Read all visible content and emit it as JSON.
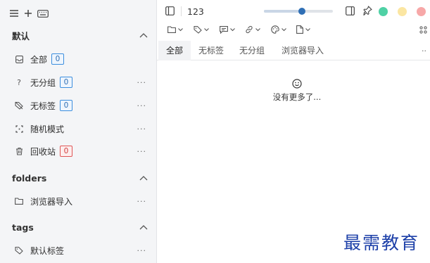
{
  "sidebar": {
    "top_icons": [
      "menu-icon",
      "plus-icon",
      "keyboard-icon"
    ],
    "groups": [
      {
        "title": "默认",
        "items": [
          {
            "label": "全部",
            "badge": "0",
            "icon": "inbox-icon"
          },
          {
            "label": "无分组",
            "badge": "0",
            "icon": "question-icon"
          },
          {
            "label": "无标签",
            "badge": "0",
            "icon": "tag-off-icon"
          },
          {
            "label": "随机模式",
            "icon": "shuffle-icon"
          },
          {
            "label": "回收站",
            "badge": "0",
            "icon": "trash-icon"
          }
        ]
      },
      {
        "title": "folders",
        "items": [
          {
            "label": "浏览器导入",
            "icon": "folder-icon"
          }
        ]
      },
      {
        "title": "tags",
        "items": [
          {
            "label": "默认标签",
            "icon": "tag-icon"
          }
        ]
      }
    ],
    "more_label": "···"
  },
  "header": {
    "title": "123",
    "zoom_slider": {
      "value_fraction": 0.55
    },
    "window_dots": {
      "green": "#4fd1a5",
      "yellow": "#fbe6a2",
      "red": "#f7a8a8"
    }
  },
  "toolbar": {
    "tools": [
      "folder-icon",
      "tag-icon",
      "comment-icon",
      "link-icon",
      "palette-icon",
      "file-icon"
    ],
    "end_icon": "grid-icon"
  },
  "tabs": [
    {
      "label": "全部",
      "active": true
    },
    {
      "label": "无标签",
      "active": false
    },
    {
      "label": "无分组",
      "active": false
    },
    {
      "label": "浏览器导入",
      "active": false
    }
  ],
  "tabs_more": "··",
  "empty_state": {
    "icon": "smile-icon",
    "text": "没有更多了..."
  },
  "watermark": "最需教育",
  "colors": {
    "accent": "#2f6fb5",
    "badge_red": "#e05555",
    "sidebar_bg": "#f4f5f7"
  }
}
